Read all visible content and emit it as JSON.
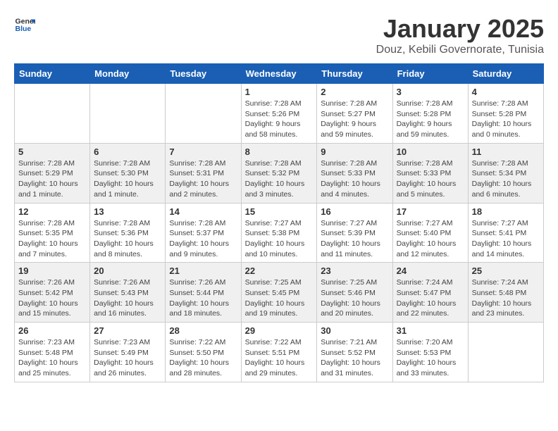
{
  "logo": {
    "general": "General",
    "blue": "Blue"
  },
  "header": {
    "month": "January 2025",
    "location": "Douz, Kebili Governorate, Tunisia"
  },
  "weekdays": [
    "Sunday",
    "Monday",
    "Tuesday",
    "Wednesday",
    "Thursday",
    "Friday",
    "Saturday"
  ],
  "weeks": [
    [
      {
        "day": null,
        "info": null
      },
      {
        "day": null,
        "info": null
      },
      {
        "day": null,
        "info": null
      },
      {
        "day": "1",
        "info": "Sunrise: 7:28 AM\nSunset: 5:26 PM\nDaylight: 9 hours\nand 58 minutes."
      },
      {
        "day": "2",
        "info": "Sunrise: 7:28 AM\nSunset: 5:27 PM\nDaylight: 9 hours\nand 59 minutes."
      },
      {
        "day": "3",
        "info": "Sunrise: 7:28 AM\nSunset: 5:28 PM\nDaylight: 9 hours\nand 59 minutes."
      },
      {
        "day": "4",
        "info": "Sunrise: 7:28 AM\nSunset: 5:28 PM\nDaylight: 10 hours\nand 0 minutes."
      }
    ],
    [
      {
        "day": "5",
        "info": "Sunrise: 7:28 AM\nSunset: 5:29 PM\nDaylight: 10 hours\nand 1 minute."
      },
      {
        "day": "6",
        "info": "Sunrise: 7:28 AM\nSunset: 5:30 PM\nDaylight: 10 hours\nand 1 minute."
      },
      {
        "day": "7",
        "info": "Sunrise: 7:28 AM\nSunset: 5:31 PM\nDaylight: 10 hours\nand 2 minutes."
      },
      {
        "day": "8",
        "info": "Sunrise: 7:28 AM\nSunset: 5:32 PM\nDaylight: 10 hours\nand 3 minutes."
      },
      {
        "day": "9",
        "info": "Sunrise: 7:28 AM\nSunset: 5:33 PM\nDaylight: 10 hours\nand 4 minutes."
      },
      {
        "day": "10",
        "info": "Sunrise: 7:28 AM\nSunset: 5:33 PM\nDaylight: 10 hours\nand 5 minutes."
      },
      {
        "day": "11",
        "info": "Sunrise: 7:28 AM\nSunset: 5:34 PM\nDaylight: 10 hours\nand 6 minutes."
      }
    ],
    [
      {
        "day": "12",
        "info": "Sunrise: 7:28 AM\nSunset: 5:35 PM\nDaylight: 10 hours\nand 7 minutes."
      },
      {
        "day": "13",
        "info": "Sunrise: 7:28 AM\nSunset: 5:36 PM\nDaylight: 10 hours\nand 8 minutes."
      },
      {
        "day": "14",
        "info": "Sunrise: 7:28 AM\nSunset: 5:37 PM\nDaylight: 10 hours\nand 9 minutes."
      },
      {
        "day": "15",
        "info": "Sunrise: 7:27 AM\nSunset: 5:38 PM\nDaylight: 10 hours\nand 10 minutes."
      },
      {
        "day": "16",
        "info": "Sunrise: 7:27 AM\nSunset: 5:39 PM\nDaylight: 10 hours\nand 11 minutes."
      },
      {
        "day": "17",
        "info": "Sunrise: 7:27 AM\nSunset: 5:40 PM\nDaylight: 10 hours\nand 12 minutes."
      },
      {
        "day": "18",
        "info": "Sunrise: 7:27 AM\nSunset: 5:41 PM\nDaylight: 10 hours\nand 14 minutes."
      }
    ],
    [
      {
        "day": "19",
        "info": "Sunrise: 7:26 AM\nSunset: 5:42 PM\nDaylight: 10 hours\nand 15 minutes."
      },
      {
        "day": "20",
        "info": "Sunrise: 7:26 AM\nSunset: 5:43 PM\nDaylight: 10 hours\nand 16 minutes."
      },
      {
        "day": "21",
        "info": "Sunrise: 7:26 AM\nSunset: 5:44 PM\nDaylight: 10 hours\nand 18 minutes."
      },
      {
        "day": "22",
        "info": "Sunrise: 7:25 AM\nSunset: 5:45 PM\nDaylight: 10 hours\nand 19 minutes."
      },
      {
        "day": "23",
        "info": "Sunrise: 7:25 AM\nSunset: 5:46 PM\nDaylight: 10 hours\nand 20 minutes."
      },
      {
        "day": "24",
        "info": "Sunrise: 7:24 AM\nSunset: 5:47 PM\nDaylight: 10 hours\nand 22 minutes."
      },
      {
        "day": "25",
        "info": "Sunrise: 7:24 AM\nSunset: 5:48 PM\nDaylight: 10 hours\nand 23 minutes."
      }
    ],
    [
      {
        "day": "26",
        "info": "Sunrise: 7:23 AM\nSunset: 5:48 PM\nDaylight: 10 hours\nand 25 minutes."
      },
      {
        "day": "27",
        "info": "Sunrise: 7:23 AM\nSunset: 5:49 PM\nDaylight: 10 hours\nand 26 minutes."
      },
      {
        "day": "28",
        "info": "Sunrise: 7:22 AM\nSunset: 5:50 PM\nDaylight: 10 hours\nand 28 minutes."
      },
      {
        "day": "29",
        "info": "Sunrise: 7:22 AM\nSunset: 5:51 PM\nDaylight: 10 hours\nand 29 minutes."
      },
      {
        "day": "30",
        "info": "Sunrise: 7:21 AM\nSunset: 5:52 PM\nDaylight: 10 hours\nand 31 minutes."
      },
      {
        "day": "31",
        "info": "Sunrise: 7:20 AM\nSunset: 5:53 PM\nDaylight: 10 hours\nand 33 minutes."
      },
      {
        "day": null,
        "info": null
      }
    ]
  ]
}
